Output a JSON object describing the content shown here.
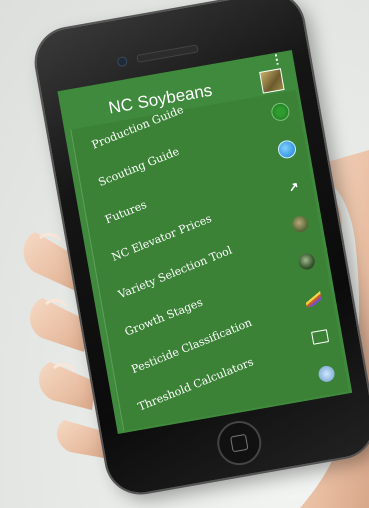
{
  "app": {
    "title": "NC Soybeans",
    "overflow_icon": "more-vert-icon",
    "header_icon": "soybean-photo-icon"
  },
  "nav": {
    "items": [
      {
        "label": "Production Guide",
        "icon": "production-guide-icon"
      },
      {
        "label": "Scouting Guide",
        "icon": "globe-icon"
      },
      {
        "label": "Futures",
        "icon": "futures-chart-icon"
      },
      {
        "label": "NC Elevator Prices",
        "icon": "elevator-photo-icon"
      },
      {
        "label": "Variety Selection Tool",
        "icon": "variety-photo-icon"
      },
      {
        "label": "Growth Stages",
        "icon": "growth-stages-icon"
      },
      {
        "label": "Pesticide Classification",
        "icon": "folder-icon"
      },
      {
        "label": "Threshold Calculators",
        "icon": "calculator-icon"
      }
    ]
  },
  "colors": {
    "screen_green": "#3f8a3c",
    "panel_green": "#3b8237",
    "phone_body": "#151515",
    "background": "#e8ebe8"
  }
}
